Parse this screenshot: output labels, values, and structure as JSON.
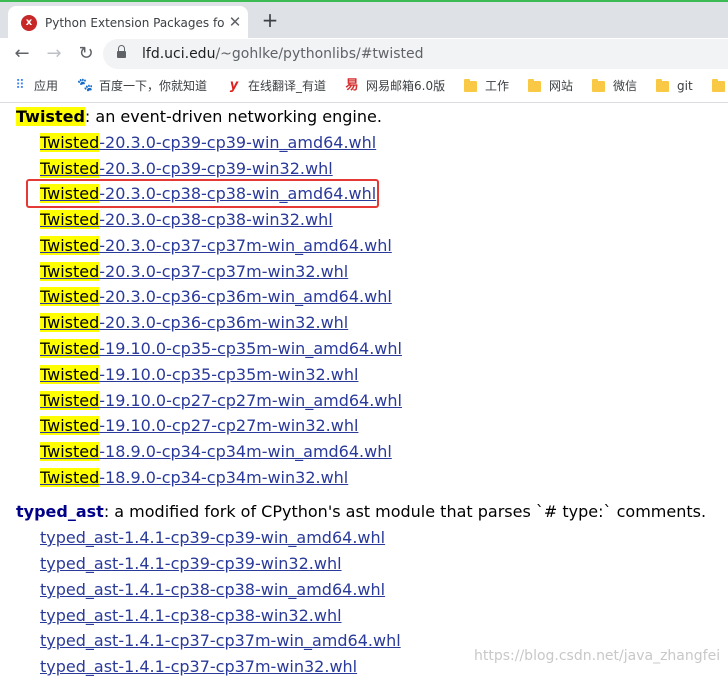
{
  "browser": {
    "tab_title": "Python Extension Packages fo",
    "url_domain": "lfd.uci.edu",
    "url_path": "/~gohlke/pythonlibs/#twisted"
  },
  "bookmarks": [
    "应用",
    "百度一下，你就知道",
    "在线翻译_有道",
    "网易邮箱6.0版",
    "工作",
    "网站",
    "微信",
    "git"
  ],
  "icons": {
    "tab_favicon": "x-logo-icon",
    "back": "arrow-left-icon",
    "forward": "arrow-right-icon",
    "reload": "reload-icon",
    "lock": "lock-icon",
    "close_tab": "close-icon",
    "new_tab": "plus-icon"
  },
  "colors": {
    "highlight": "#ffff00",
    "link": "#2a3a9a",
    "selection_box": "#e53935"
  },
  "sections": [
    {
      "name": "Twisted",
      "description": ": an event-driven networking engine.",
      "highlight_name": true,
      "files": [
        "-20.3.0-cp39-cp39-win_amd64.whl",
        "-20.3.0-cp39-cp39-win32.whl",
        "-20.3.0-cp38-cp38-win_amd64.whl",
        "-20.3.0-cp38-cp38-win32.whl",
        "-20.3.0-cp37-cp37m-win_amd64.whl",
        "-20.3.0-cp37-cp37m-win32.whl",
        "-20.3.0-cp36-cp36m-win_amd64.whl",
        "-20.3.0-cp36-cp36m-win32.whl",
        "-19.10.0-cp35-cp35m-win_amd64.whl",
        "-19.10.0-cp35-cp35m-win32.whl",
        "-19.10.0-cp27-cp27m-win_amd64.whl",
        "-19.10.0-cp27-cp27m-win32.whl",
        "-18.9.0-cp34-cp34m-win_amd64.whl",
        "-18.9.0-cp34-cp34m-win32.whl"
      ],
      "selected_file": "-20.3.0-cp38-cp38-win_amd64.whl"
    },
    {
      "name": "typed_ast",
      "description": ": a modified fork of CPython's ast module that parses `# type:` comments.",
      "highlight_name": false,
      "files": [
        "typed_ast-1.4.1-cp39-cp39-win_amd64.whl",
        "typed_ast-1.4.1-cp39-cp39-win32.whl",
        "typed_ast-1.4.1-cp38-cp38-win_amd64.whl",
        "typed_ast-1.4.1-cp38-cp38-win32.whl",
        "typed_ast-1.4.1-cp37-cp37m-win_amd64.whl",
        "typed_ast-1.4.1-cp37-cp37m-win32.whl"
      ]
    }
  ],
  "watermark": "https://blog.csdn.net/java_zhangfei"
}
